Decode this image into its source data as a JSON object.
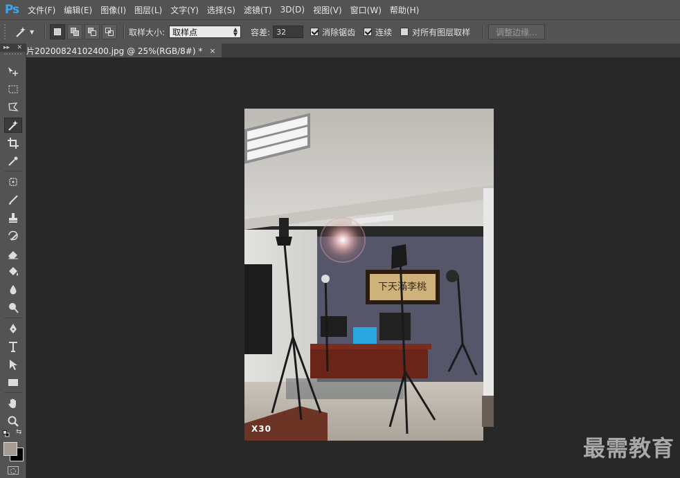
{
  "app": {
    "logo": "Ps"
  },
  "menu": [
    "文件(F)",
    "编辑(E)",
    "图像(I)",
    "图层(L)",
    "文字(Y)",
    "选择(S)",
    "滤镜(T)",
    "3D(D)",
    "视图(V)",
    "窗口(W)",
    "帮助(H)"
  ],
  "options": {
    "sample_size_label": "取样大小:",
    "sample_size_value": "取样点",
    "tolerance_label": "容差:",
    "tolerance_value": "32",
    "antialias_label": "消除锯齿",
    "antialias_checked": true,
    "contiguous_label": "连续",
    "contiguous_checked": true,
    "all_layers_label": "对所有图层取样",
    "all_layers_checked": false,
    "refine_edge_label": "调整边缘..."
  },
  "document": {
    "tab_title": "片20200824102400.jpg @ 25%(RGB/8#) *",
    "close_glyph": "×",
    "zoom_percent": 25,
    "photo_overlay": "X30"
  },
  "toolbox": {
    "header_left": "▸▸",
    "header_right": "✕",
    "active_tool": "magic-wand-tool"
  },
  "watermark": "最需教育",
  "colors": {
    "foreground": "#a79c92",
    "background": "#000000",
    "ui_panel": "#535353",
    "workspace": "#282828"
  }
}
